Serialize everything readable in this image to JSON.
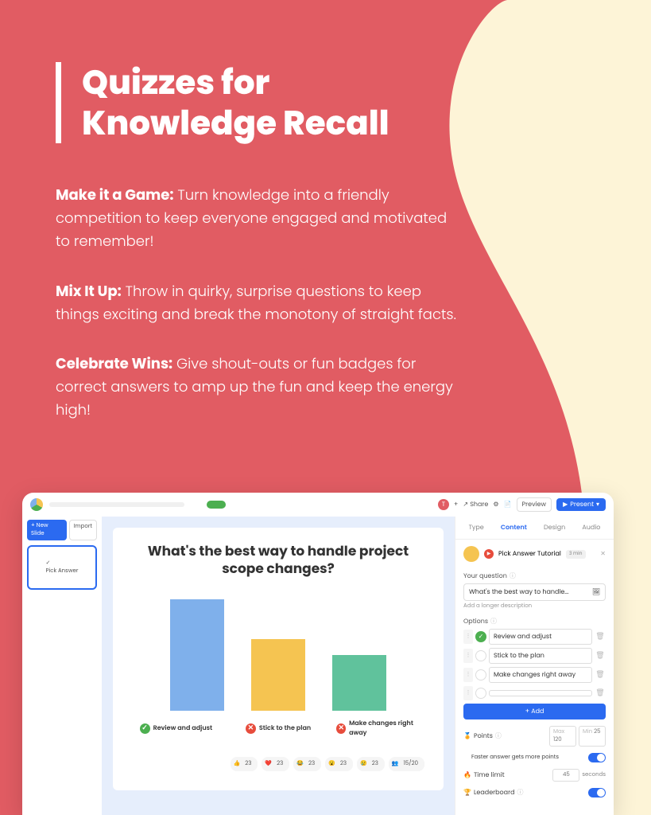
{
  "heading": "Quizzes for\nKnowledge Recall",
  "tips": [
    {
      "bold": "Make it a Game:",
      "text": " Turn knowledge into a friendly competition to keep everyone engaged and motivated to remember!"
    },
    {
      "bold": "Mix It Up:",
      "text": " Throw in quirky, surprise questions to keep things exciting and break the monotony of straight facts."
    },
    {
      "bold": "Celebrate Wins:",
      "text": " Give shout-outs or fun badges for correct answers to amp up the fun and keep the energy high!"
    }
  ],
  "app": {
    "topbar": {
      "avatar_letter": "T",
      "plus": "+",
      "share": "Share",
      "preview": "Preview",
      "present": "Present"
    },
    "left": {
      "new_slide": "+ New Slide",
      "import": "Import",
      "thumb_label": "Pick Answer"
    },
    "slide": {
      "title": "What's the best way to handle project scope changes?",
      "options": [
        {
          "label": "Review and adjust",
          "correct": true
        },
        {
          "label": "Stick to the plan",
          "correct": false
        },
        {
          "label": "Make changes right away",
          "correct": false
        }
      ],
      "reaction_count": "23",
      "participants": "15/20"
    },
    "right": {
      "tabs": [
        "Type",
        "Content",
        "Design",
        "Audio"
      ],
      "active_tab": 1,
      "tutorial_title": "Pick Answer Tutorial",
      "tutorial_time": "3 min",
      "your_question_label": "Your question",
      "question_value": "What's the best way to handle...",
      "add_desc": "Add a longer description",
      "options_label": "Options",
      "options": [
        "Review and adjust",
        "Stick to the plan",
        "Make changes right away",
        ""
      ],
      "add_btn": "+ Add",
      "points_label": "Points",
      "points_max_label": "Max",
      "points_max": "120",
      "points_min_label": "Min",
      "points_min": "25",
      "faster_label": "Faster answer gets more points",
      "time_label": "Time limit",
      "time_value": "45",
      "time_unit": "seconds",
      "leaderboard_label": "Leaderboard"
    }
  },
  "chart_data": {
    "type": "bar",
    "title": "What's the best way to handle project scope changes?",
    "categories": [
      "Review and adjust",
      "Stick to the plan",
      "Make changes right away"
    ],
    "values": [
      140,
      90,
      70
    ]
  }
}
